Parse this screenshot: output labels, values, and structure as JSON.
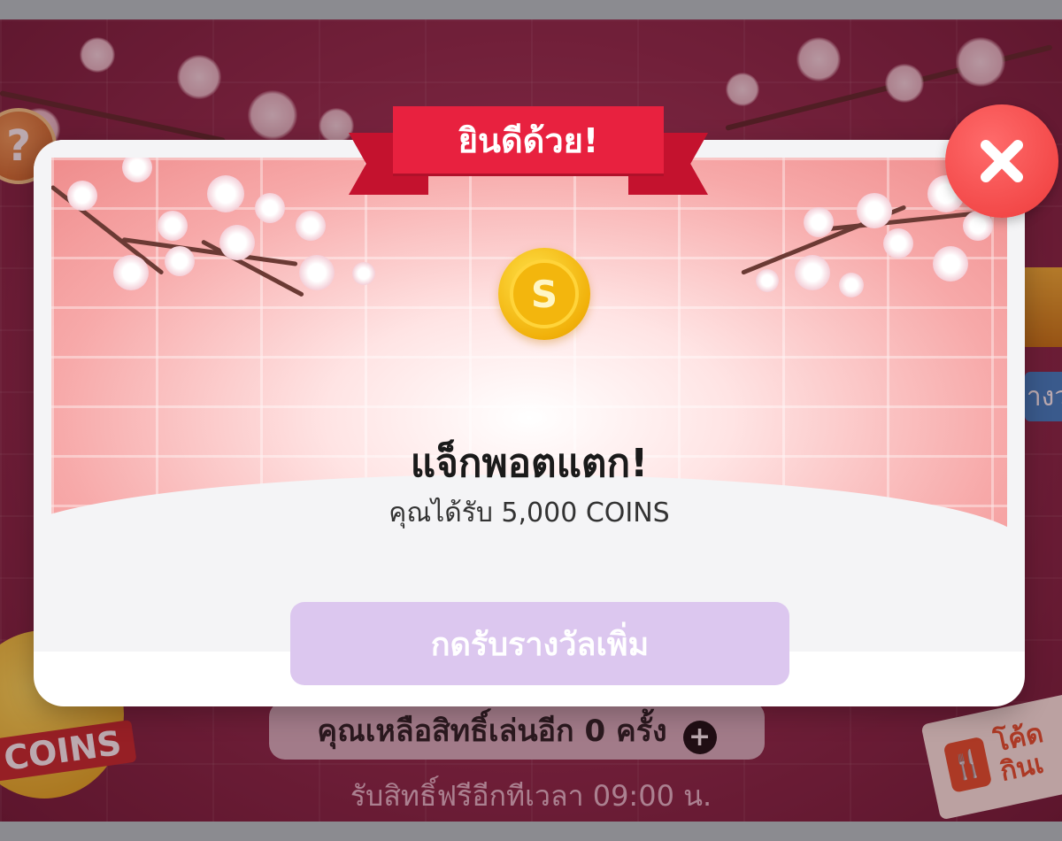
{
  "modal": {
    "ribbon_title": "ยินดีด้วย!",
    "headline": "แจ็กพอตแตก!",
    "subline": "คุณได้รับ 5,000 COINS",
    "claim_button": "กดรับรางวัลเพิ่ม",
    "coin_symbol": "S",
    "close_icon": "close-icon"
  },
  "background": {
    "help_label": "?",
    "coins_badge_label": "COINS",
    "remaining_text": "คุณเหลือสิทธิ์เล่นอีก 0 ครั้ง",
    "free_time_text": "รับสิทธิ์ฟรีอีกทีเวลา 09:00 น.",
    "side_label": "างว",
    "coupon_text": "โค้ด กินเ"
  },
  "colors": {
    "ribbon": "#e8213f",
    "close": "#ee3b3b",
    "claim_button": "#dcc7ef",
    "coin": "#f1b10a"
  }
}
